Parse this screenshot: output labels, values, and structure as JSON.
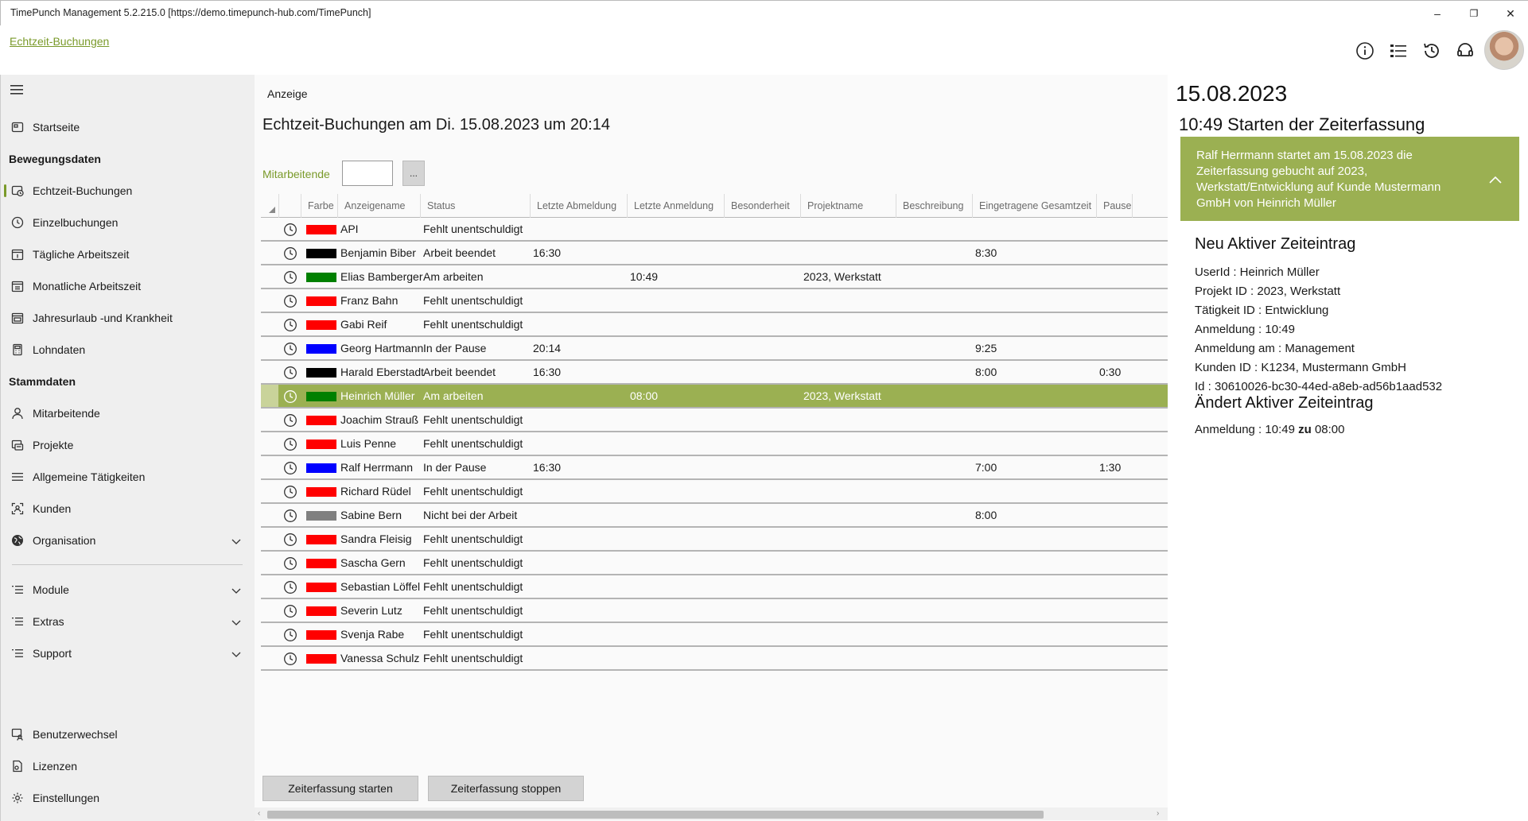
{
  "window": {
    "title": "TimePunch Management 5.2.215.0 [https://demo.timepunch-hub.com/TimePunch]",
    "minimize": "–",
    "restore": "❐",
    "close": "✕"
  },
  "header": {
    "breadcrumb": "Echtzeit-Buchungen",
    "icons": [
      "info-icon",
      "list-icon",
      "history-icon",
      "headset-icon"
    ]
  },
  "sidebar": {
    "top_items": [
      {
        "label": "Startseite",
        "icon": "home-icon"
      }
    ],
    "section1": "Bewegungsdaten",
    "section1_items": [
      {
        "label": "Echtzeit-Buchungen",
        "icon": "realtime-icon",
        "active": true
      },
      {
        "label": "Einzelbuchungen",
        "icon": "clock-icon"
      },
      {
        "label": "Tägliche Arbeitszeit",
        "icon": "calendar-day-icon"
      },
      {
        "label": "Monatliche Arbeitszeit",
        "icon": "calendar-month-icon"
      },
      {
        "label": "Jahresurlaub -und Krankheit",
        "icon": "calendar-year-icon"
      },
      {
        "label": "Lohndaten",
        "icon": "calculator-icon"
      }
    ],
    "section2": "Stammdaten",
    "section2_items": [
      {
        "label": "Mitarbeitende",
        "icon": "person-icon"
      },
      {
        "label": "Projekte",
        "icon": "project-icon"
      },
      {
        "label": "Allgemeine Tätigkeiten",
        "icon": "list-icon"
      },
      {
        "label": "Kunden",
        "icon": "customer-icon"
      },
      {
        "label": "Organisation",
        "icon": "globe-icon"
      }
    ],
    "collapsible": [
      {
        "label": "Module",
        "icon": "list-icon"
      },
      {
        "label": "Extras",
        "icon": "list-icon"
      },
      {
        "label": "Support",
        "icon": "list-icon"
      }
    ],
    "bottom_items": [
      {
        "label": "Benutzerwechsel",
        "icon": "user-switch-icon"
      },
      {
        "label": "Lizenzen",
        "icon": "license-icon"
      },
      {
        "label": "Einstellungen",
        "icon": "settings-icon"
      }
    ]
  },
  "main": {
    "section_label": "Anzeige",
    "title": "Echtzeit-Buchungen am Di. 15.08.2023 um 20:14",
    "filter_label": "Mitarbeitende",
    "filter_value": "",
    "filter_button": "...",
    "columns": [
      "Farbe",
      "Anzeigename",
      "Status",
      "Letzte Abmeldung",
      "Letzte Anmeldung",
      "Besonderheit",
      "Projektname",
      "Beschreibung",
      "Eingetragene Gesamtzeit",
      "Pause"
    ],
    "rows": [
      {
        "color": "#ff0000",
        "name": "API",
        "status": "Fehlt unentschuldigt",
        "abmeldung": "",
        "anmeldung": "",
        "projekt": "",
        "gesamt": "",
        "pause": ""
      },
      {
        "color": "#000000",
        "name": "Benjamin Biber",
        "status": "Arbeit beendet",
        "abmeldung": "16:30",
        "anmeldung": "",
        "projekt": "",
        "gesamt": "8:30",
        "pause": ""
      },
      {
        "color": "#008000",
        "name": "Elias Bamberger",
        "status": "Am arbeiten",
        "abmeldung": "",
        "anmeldung": "10:49",
        "projekt": "2023, Werkstatt",
        "gesamt": "",
        "pause": ""
      },
      {
        "color": "#ff0000",
        "name": "Franz Bahn",
        "status": "Fehlt unentschuldigt",
        "abmeldung": "",
        "anmeldung": "",
        "projekt": "",
        "gesamt": "",
        "pause": ""
      },
      {
        "color": "#ff0000",
        "name": "Gabi Reif",
        "status": "Fehlt unentschuldigt",
        "abmeldung": "",
        "anmeldung": "",
        "projekt": "",
        "gesamt": "",
        "pause": ""
      },
      {
        "color": "#0000ff",
        "name": "Georg Hartmann",
        "status": "In der Pause",
        "abmeldung": "20:14",
        "anmeldung": "",
        "projekt": "",
        "gesamt": "9:25",
        "pause": ""
      },
      {
        "color": "#000000",
        "name": "Harald Eberstadt",
        "status": "Arbeit beendet",
        "abmeldung": "16:30",
        "anmeldung": "",
        "projekt": "",
        "gesamt": "8:00",
        "pause": "0:30"
      },
      {
        "color": "#008000",
        "name": "Heinrich  Müller",
        "status": "Am arbeiten",
        "abmeldung": "",
        "anmeldung": "08:00",
        "projekt": "2023, Werkstatt",
        "gesamt": "",
        "pause": "",
        "selected": true
      },
      {
        "color": "#ff0000",
        "name": "Joachim Strauß",
        "status": "Fehlt unentschuldigt",
        "abmeldung": "",
        "anmeldung": "",
        "projekt": "",
        "gesamt": "",
        "pause": ""
      },
      {
        "color": "#ff0000",
        "name": "Luis Penne",
        "status": "Fehlt unentschuldigt",
        "abmeldung": "",
        "anmeldung": "",
        "projekt": "",
        "gesamt": "",
        "pause": ""
      },
      {
        "color": "#0000ff",
        "name": "Ralf Herrmann",
        "status": "In der Pause",
        "abmeldung": "16:30",
        "anmeldung": "",
        "projekt": "",
        "gesamt": "7:00",
        "pause": "1:30"
      },
      {
        "color": "#ff0000",
        "name": "Richard Rüdel",
        "status": "Fehlt unentschuldigt",
        "abmeldung": "",
        "anmeldung": "",
        "projekt": "",
        "gesamt": "",
        "pause": ""
      },
      {
        "color": "#808080",
        "name": "Sabine Bern",
        "status": "Nicht bei der Arbeit",
        "abmeldung": "",
        "anmeldung": "",
        "projekt": "",
        "gesamt": "8:00",
        "pause": ""
      },
      {
        "color": "#ff0000",
        "name": "Sandra Fleisig",
        "status": "Fehlt unentschuldigt",
        "abmeldung": "",
        "anmeldung": "",
        "projekt": "",
        "gesamt": "",
        "pause": ""
      },
      {
        "color": "#ff0000",
        "name": "Sascha Gern",
        "status": "Fehlt unentschuldigt",
        "abmeldung": "",
        "anmeldung": "",
        "projekt": "",
        "gesamt": "",
        "pause": ""
      },
      {
        "color": "#ff0000",
        "name": "Sebastian Löffel",
        "status": "Fehlt unentschuldigt",
        "abmeldung": "",
        "anmeldung": "",
        "projekt": "",
        "gesamt": "",
        "pause": ""
      },
      {
        "color": "#ff0000",
        "name": "Severin Lutz",
        "status": "Fehlt unentschuldigt",
        "abmeldung": "",
        "anmeldung": "",
        "projekt": "",
        "gesamt": "",
        "pause": ""
      },
      {
        "color": "#ff0000",
        "name": "Svenja Rabe",
        "status": "Fehlt unentschuldigt",
        "abmeldung": "",
        "anmeldung": "",
        "projekt": "",
        "gesamt": "",
        "pause": ""
      },
      {
        "color": "#ff0000",
        "name": "Vanessa Schulz",
        "status": "Fehlt unentschuldigt",
        "abmeldung": "",
        "anmeldung": "",
        "projekt": "",
        "gesamt": "",
        "pause": ""
      }
    ],
    "buttons": {
      "start": "Zeiterfassung starten",
      "stop": "Zeiterfassung stoppen"
    }
  },
  "details": {
    "date": "15.08.2023",
    "event_title": "10:49 Starten der Zeiterfassung",
    "banner": "Ralf Herrmann startet am 15.08.2023 die Zeiterfassung gebucht auf 2023, Werkstatt/Entwicklung auf Kunde Mustermann GmbH von Heinrich Müller",
    "new_entry_heading": "Neu Aktiver Zeiteintrag",
    "new_entry_lines": [
      "UserId : Heinrich Müller",
      "Projekt ID : 2023, Werkstatt",
      "Tätigkeit ID : Entwicklung",
      "Anmeldung : 10:49",
      "Anmeldung am : Management",
      "Kunden ID : K1234, Mustermann GmbH",
      "Id : 30610026-bc30-44ed-a8eb-ad56b1aad532"
    ],
    "change_heading": "Ändert Aktiver Zeiteintrag",
    "change_prefix": "Anmeldung : 10:49",
    "change_word": "zu",
    "change_suffix": "08:00"
  },
  "colors": {
    "accent": "#9bb052",
    "link": "#7a9a2a"
  }
}
